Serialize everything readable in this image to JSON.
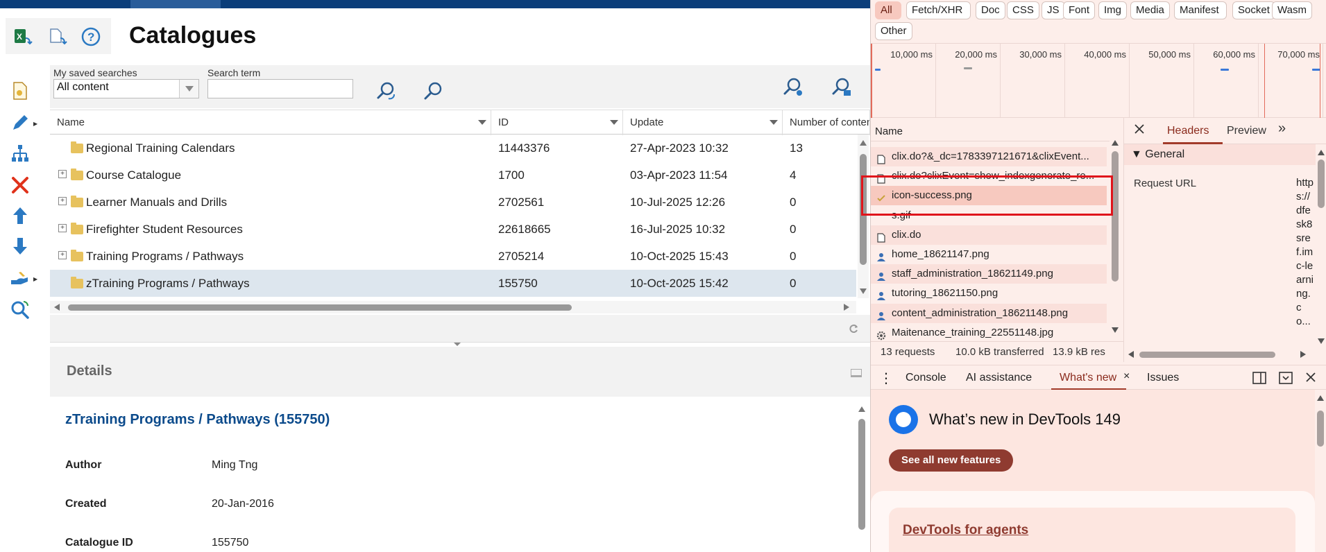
{
  "app": {
    "page_title": "Catalogues",
    "search": {
      "saved_label": "My saved searches",
      "saved_value": "All content",
      "term_label": "Search term",
      "term_value": ""
    },
    "grid": {
      "columns": [
        "Name",
        "ID",
        "Update",
        "Number of conten"
      ],
      "rows": [
        {
          "name": "Regional Training Calendars",
          "id": "11443376",
          "update": "27-Apr-2023 10:32",
          "count": "13",
          "expandable": false,
          "selected": false
        },
        {
          "name": "Course Catalogue",
          "id": "1700",
          "update": "03-Apr-2023 11:54",
          "count": "4",
          "expandable": true,
          "selected": false
        },
        {
          "name": "Learner Manuals and Drills",
          "id": "2702561",
          "update": "10-Jul-2025 12:26",
          "count": "0",
          "expandable": true,
          "selected": false
        },
        {
          "name": "Firefighter Student Resources",
          "id": "22618665",
          "update": "16-Jul-2025 10:32",
          "count": "0",
          "expandable": true,
          "selected": false
        },
        {
          "name": "Training Programs / Pathways",
          "id": "2705214",
          "update": "10-Oct-2025 15:43",
          "count": "0",
          "expandable": true,
          "selected": false
        },
        {
          "name": "zTraining Programs / Pathways",
          "id": "155750",
          "update": "10-Oct-2025 15:42",
          "count": "0",
          "expandable": false,
          "selected": true
        }
      ]
    },
    "details": {
      "title": "Details",
      "record_title": "zTraining Programs / Pathways (155750)",
      "fields": [
        {
          "key": "Author",
          "value": "Ming Tng"
        },
        {
          "key": "Created",
          "value": "20-Jan-2016"
        },
        {
          "key": "Catalogue ID",
          "value": "155750"
        }
      ]
    },
    "expand_glyph": "+",
    "colors": {
      "topbar": "#0b3e7a",
      "link_blue": "#0b4a8b",
      "selected_row": "#dde6ee",
      "delete_red": "#e0321b"
    }
  },
  "devtools": {
    "filters": [
      "All",
      "Fetch/XHR",
      "Doc",
      "CSS",
      "JS",
      "Font",
      "Img",
      "Media",
      "Manifest",
      "Socket",
      "Wasm",
      "Other"
    ],
    "active_filter": "All",
    "timeline_ticks": [
      "10,000 ms",
      "20,000 ms",
      "30,000 ms",
      "40,000 ms",
      "50,000 ms",
      "60,000 ms",
      "70,000 ms"
    ],
    "network": {
      "header": "Name",
      "requests": [
        {
          "name": "clix.do?&_dc=1783397121671&clixEvent...",
          "icon": "document-icon"
        },
        {
          "name": "clix.do?clixEvent=show_indexgenerate_re...",
          "icon": "document-icon"
        },
        {
          "name": "icon-success.png",
          "icon": "check-icon"
        },
        {
          "name": "s.gif",
          "icon": "none"
        },
        {
          "name": "clix.do",
          "icon": "document-icon"
        },
        {
          "name": "home_18621147.png",
          "icon": "person-icon"
        },
        {
          "name": "staff_administration_18621149.png",
          "icon": "person-icon"
        },
        {
          "name": "tutoring_18621150.png",
          "icon": "person-icon"
        },
        {
          "name": "content_administration_18621148.png",
          "icon": "person-icon"
        },
        {
          "name": "Maitenance_training_22551148.jpg",
          "icon": "gear-icon"
        }
      ],
      "status": {
        "requests": "13 requests",
        "transferred": "10.0 kB transferred",
        "resources": "13.9 kB res"
      }
    },
    "headers_panel": {
      "tabs": [
        "Headers",
        "Preview"
      ],
      "more": "»",
      "general": "▼ General",
      "request_url_label": "Request URL",
      "request_url_value": "https://dfesk8sref.imc-learning.co..."
    },
    "drawer": {
      "tabs": [
        "Console",
        "AI assistance",
        "What's new",
        "Issues"
      ],
      "whats_new_title": "What’s new in DevTools 149",
      "see_all": "See all new features",
      "card_link": "DevTools for agents"
    },
    "colors": {
      "accent": "#a23b2a",
      "bg": "#fdeeea",
      "highlight": "#f7c9bf",
      "annotation_red": "#e0141b"
    }
  }
}
